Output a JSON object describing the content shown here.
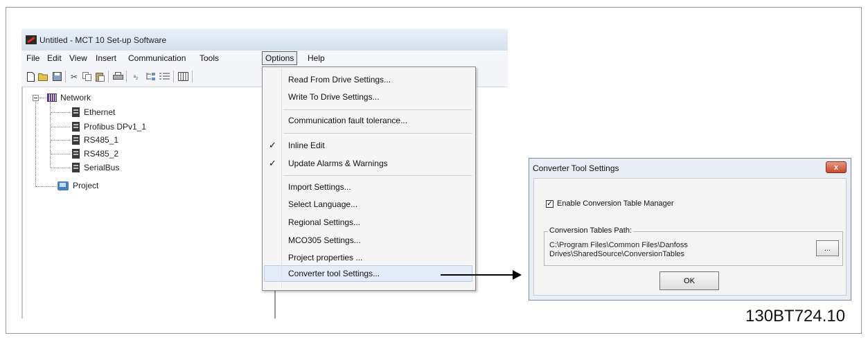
{
  "window": {
    "title": "Untitled - MCT 10 Set-up Software"
  },
  "menubar": {
    "items": [
      "File",
      "Edit",
      "View",
      "Insert",
      "Communication",
      "Tools",
      "Options",
      "Help"
    ],
    "active": "Options"
  },
  "toolbar": {
    "icons": [
      "new-file-icon",
      "open-folder-icon",
      "save-icon",
      "cut-icon",
      "copy-icon",
      "paste-icon",
      "print-icon",
      "sort-icon",
      "tree-icon",
      "list-icon",
      "columns-icon"
    ]
  },
  "tree": {
    "root": "Network",
    "children": [
      "Ethernet",
      "Profibus DPv1_1",
      "RS485_1",
      "RS485_2",
      "SerialBus"
    ],
    "project": "Project"
  },
  "options_menu": {
    "items": [
      {
        "label": "Read From Drive Settings...",
        "checked": false
      },
      {
        "label": "Write To Drive Settings...",
        "checked": false
      },
      {
        "label": "Communication fault tolerance...",
        "checked": false
      },
      {
        "label": "Inline Edit",
        "checked": true
      },
      {
        "label": "Update Alarms & Warnings",
        "checked": true
      },
      {
        "label": "Import Settings...",
        "checked": false
      },
      {
        "label": "Select Language...",
        "checked": false
      },
      {
        "label": "Regional Settings...",
        "checked": false
      },
      {
        "label": "MCO305 Settings...",
        "checked": false
      },
      {
        "label": "Project properties ...",
        "checked": false
      },
      {
        "label": "Converter tool Settings...",
        "checked": false,
        "highlighted": true
      }
    ],
    "check_mark": "✓"
  },
  "dialog": {
    "title": "Converter Tool Settings",
    "close_label": "x",
    "checkbox_label": "Enable Conversion Table Manager",
    "checkbox_checked": true,
    "checkbox_mark": "✓",
    "group_label": "Conversion Tables Path:",
    "path_line1": "C:\\Program Files\\Common Files\\Danfoss",
    "path_line2": "Drives\\SharedSource\\ConversionTables",
    "browse_label": "...",
    "ok_label": "OK"
  },
  "figure_id": "130BT724.10",
  "colors": {
    "dialog_bg": "#e9eef5",
    "close_button": "#c44a2e",
    "menu_highlight": "#e3ecf7"
  }
}
